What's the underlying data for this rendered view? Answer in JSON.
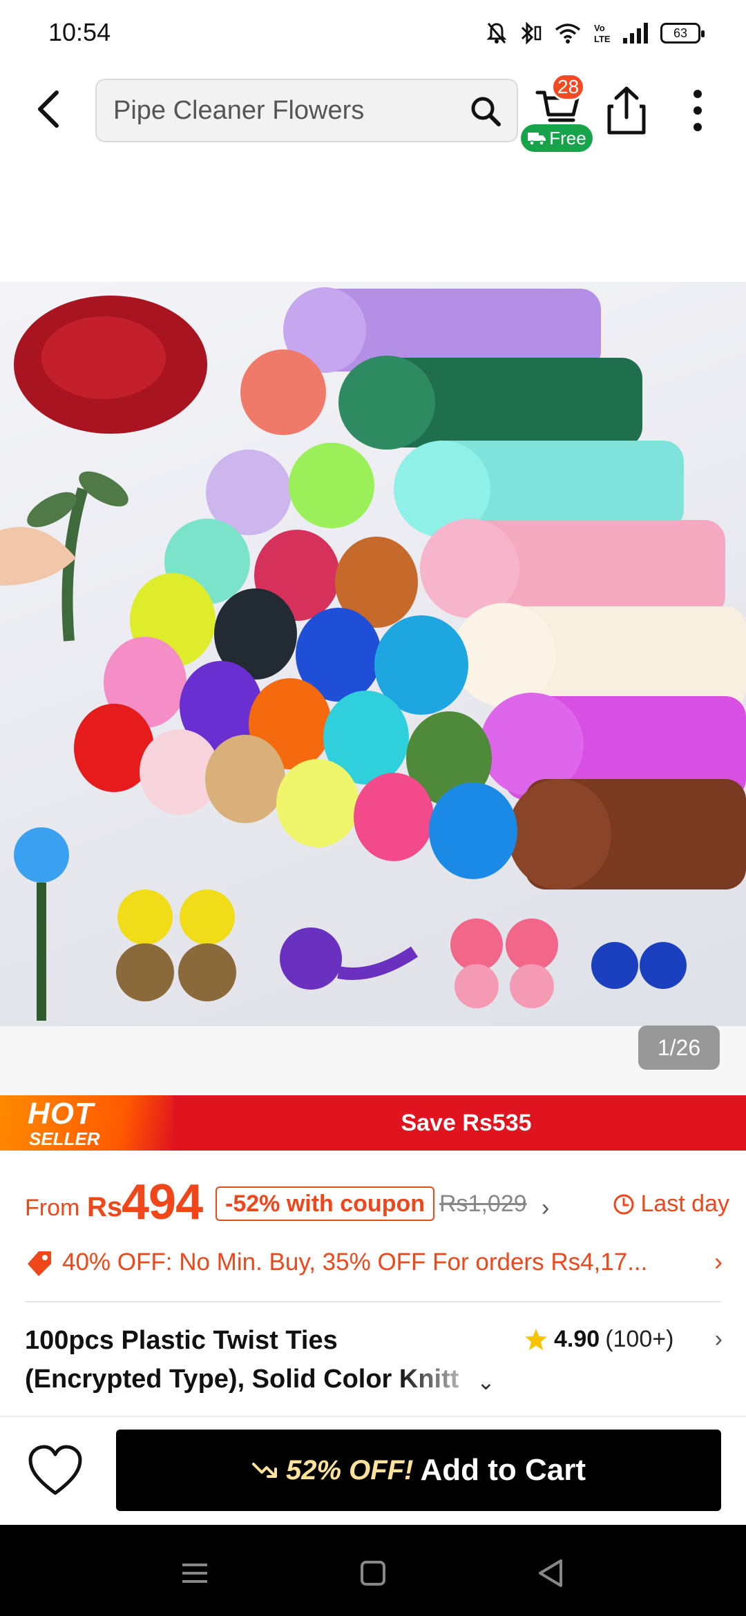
{
  "status_bar": {
    "time": "10:54",
    "battery": "63",
    "icons": [
      "mute-icon",
      "bluetooth-icon",
      "wifi-icon",
      "volte-icon",
      "signal-icon",
      "battery-icon"
    ]
  },
  "header": {
    "search_value": "Pipe Cleaner Flowers",
    "cart_count": "28",
    "free_label": "Free"
  },
  "gallery": {
    "counter": "1/26"
  },
  "banner": {
    "hot": "HOT",
    "seller": "SELLER",
    "save_text": "Save Rs535",
    "color": "#e0141e"
  },
  "price": {
    "from_label": "From",
    "currency": "Rs",
    "value": "494",
    "coupon": "-52% with coupon",
    "original": "Rs1,029",
    "deadline": "Last day",
    "accent_color": "#f0471a"
  },
  "discount": {
    "text": "40% OFF: No Min. Buy,  35% OFF For orders Rs4,17..."
  },
  "product": {
    "title_line_1": "100pcs Plastic Twist Ties",
    "title_line_2": "(Encrypted Type), Solid Color Knitt",
    "rating": "4.90",
    "rating_count": "(100+)"
  },
  "bottom_bar": {
    "off_label": "52% OFF!",
    "add_to_cart": "Add to Cart"
  }
}
